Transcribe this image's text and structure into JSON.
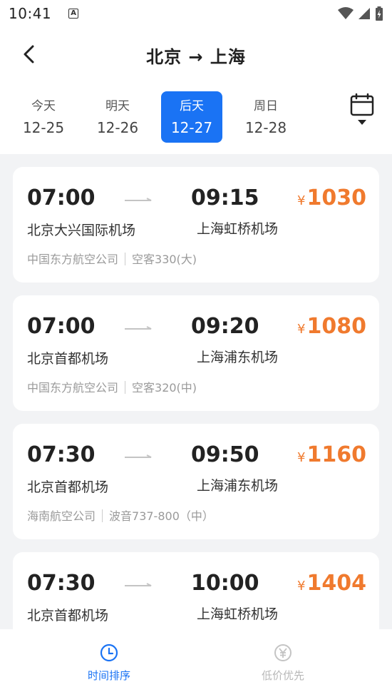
{
  "status_bar": {
    "time": "10:41",
    "app_badge": "A"
  },
  "header": {
    "title": "北京 → 上海",
    "back_icon": "chevron-left-icon"
  },
  "date_tabs": [
    {
      "label": "今天",
      "date": "12-25",
      "active": false
    },
    {
      "label": "明天",
      "date": "12-26",
      "active": false
    },
    {
      "label": "后天",
      "date": "12-27",
      "active": true
    },
    {
      "label": "周日",
      "date": "12-28",
      "active": false
    }
  ],
  "calendar_icon": "calendar-icon",
  "flights": [
    {
      "dep_time": "07:00",
      "arr_time": "09:15",
      "dep_airport": "北京大兴国际机场",
      "arr_airport": "上海虹桥机场",
      "price_symbol": "¥",
      "price": "1030",
      "airline": "中国东方航空公司",
      "aircraft": "空客330(大)"
    },
    {
      "dep_time": "07:00",
      "arr_time": "09:20",
      "dep_airport": "北京首都机场",
      "arr_airport": "上海浦东机场",
      "price_symbol": "¥",
      "price": "1080",
      "airline": "中国东方航空公司",
      "aircraft": "空客320(中)"
    },
    {
      "dep_time": "07:30",
      "arr_time": "09:50",
      "dep_airport": "北京首都机场",
      "arr_airport": "上海浦东机场",
      "price_symbol": "¥",
      "price": "1160",
      "airline": "海南航空公司",
      "aircraft": "波音737-800（中）"
    },
    {
      "dep_time": "07:30",
      "arr_time": "10:00",
      "dep_airport": "北京首都机场",
      "arr_airport": "上海虹桥机场",
      "price_symbol": "¥",
      "price": "1404",
      "airline": "",
      "aircraft": ""
    }
  ],
  "bottom_nav": [
    {
      "label": "时间排序",
      "icon": "clock-icon",
      "active": true
    },
    {
      "label": "低价优先",
      "icon": "yen-icon",
      "active": false
    }
  ],
  "colors": {
    "accent": "#1a73f4",
    "price": "#f07a2e"
  }
}
